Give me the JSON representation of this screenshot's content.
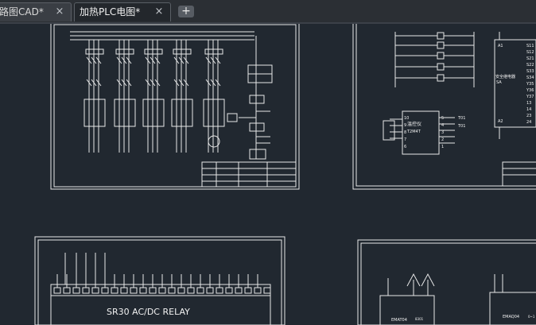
{
  "tabs": [
    {
      "label": "路图CAD*",
      "close": "×"
    },
    {
      "label": "加热PLC电图*",
      "close": "×"
    }
  ],
  "new_tab": "+",
  "drawing": {
    "plc_label": "SR30 AC/DC RELAY",
    "temp_controller": {
      "name": "温控仪",
      "model": "T2M4T"
    },
    "temp_terms_left": [
      "10",
      "9",
      "8",
      "7",
      "6"
    ],
    "temp_terms_right": [
      "5",
      "4",
      "3",
      "2",
      "1"
    ],
    "temp_out_labels": [
      "T01",
      "T01"
    ],
    "safety_relay": {
      "name": "安全继电器",
      "model": "SA"
    },
    "relay_pins_left": [
      "A1",
      "A2"
    ],
    "relay_pins_right": [
      "S11",
      "S12",
      "S21",
      "S22",
      "S33",
      "S34",
      "Y35",
      "Y36",
      "Y37",
      "13",
      "14",
      "23",
      "24"
    ],
    "module_left": "EMAT04",
    "module_left_sub": "8301",
    "module_right": "EMAQ04",
    "module_right_sub": "0~1"
  }
}
